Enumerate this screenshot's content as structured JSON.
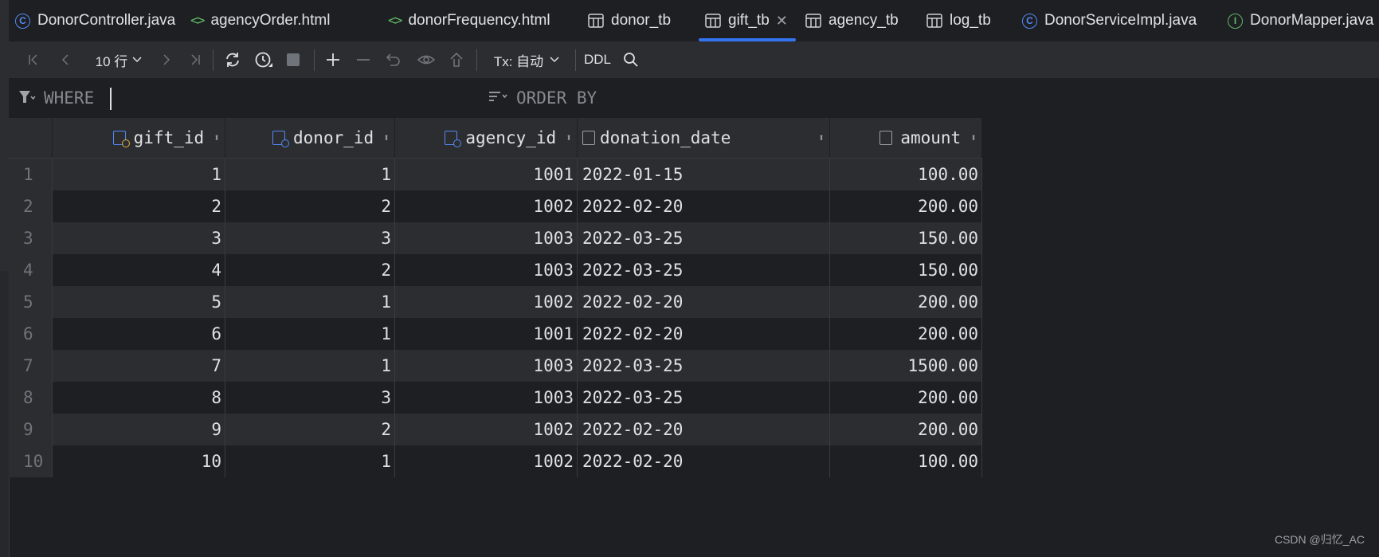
{
  "tabs": [
    {
      "label": "DonorController.java",
      "icon": "class-icon"
    },
    {
      "label": "agencyOrder.html",
      "icon": "html-icon"
    },
    {
      "label": "donorFrequency.html",
      "icon": "html-icon"
    },
    {
      "label": "donor_tb",
      "icon": "table-icon"
    },
    {
      "label": "gift_tb",
      "icon": "table-icon",
      "active": true
    },
    {
      "label": "agency_tb",
      "icon": "table-icon"
    },
    {
      "label": "log_tb",
      "icon": "table-icon"
    },
    {
      "label": "DonorServiceImpl.java",
      "icon": "class-icon"
    },
    {
      "label": "DonorMapper.java",
      "icon": "interface-icon"
    }
  ],
  "toolbar": {
    "page_size": "10 行",
    "tx_mode": "Tx: 自动",
    "ddl": "DDL"
  },
  "filter": {
    "where_label": "WHERE",
    "order_label": "ORDER BY"
  },
  "table": {
    "columns": [
      "gift_id",
      "donor_id",
      "agency_id",
      "donation_date",
      "amount"
    ],
    "rows": [
      {
        "n": "1",
        "gift_id": "1",
        "donor_id": "1",
        "agency_id": "1001",
        "donation_date": "2022-01-15",
        "amount": "100.00"
      },
      {
        "n": "2",
        "gift_id": "2",
        "donor_id": "2",
        "agency_id": "1002",
        "donation_date": "2022-02-20",
        "amount": "200.00"
      },
      {
        "n": "3",
        "gift_id": "3",
        "donor_id": "3",
        "agency_id": "1003",
        "donation_date": "2022-03-25",
        "amount": "150.00"
      },
      {
        "n": "4",
        "gift_id": "4",
        "donor_id": "2",
        "agency_id": "1003",
        "donation_date": "2022-03-25",
        "amount": "150.00"
      },
      {
        "n": "5",
        "gift_id": "5",
        "donor_id": "1",
        "agency_id": "1002",
        "donation_date": "2022-02-20",
        "amount": "200.00"
      },
      {
        "n": "6",
        "gift_id": "6",
        "donor_id": "1",
        "agency_id": "1001",
        "donation_date": "2022-02-20",
        "amount": "200.00"
      },
      {
        "n": "7",
        "gift_id": "7",
        "donor_id": "1",
        "agency_id": "1003",
        "donation_date": "2022-03-25",
        "amount": "1500.00"
      },
      {
        "n": "8",
        "gift_id": "8",
        "donor_id": "3",
        "agency_id": "1003",
        "donation_date": "2022-03-25",
        "amount": "200.00"
      },
      {
        "n": "9",
        "gift_id": "9",
        "donor_id": "2",
        "agency_id": "1002",
        "donation_date": "2022-02-20",
        "amount": "200.00"
      },
      {
        "n": "10",
        "gift_id": "10",
        "donor_id": "1",
        "agency_id": "1002",
        "donation_date": "2022-02-20",
        "amount": "100.00"
      }
    ]
  },
  "watermark": "CSDN @归忆_AC",
  "colors": {
    "accent": "#3574f0",
    "background": "#1e1f22",
    "panel": "#2b2d30"
  }
}
